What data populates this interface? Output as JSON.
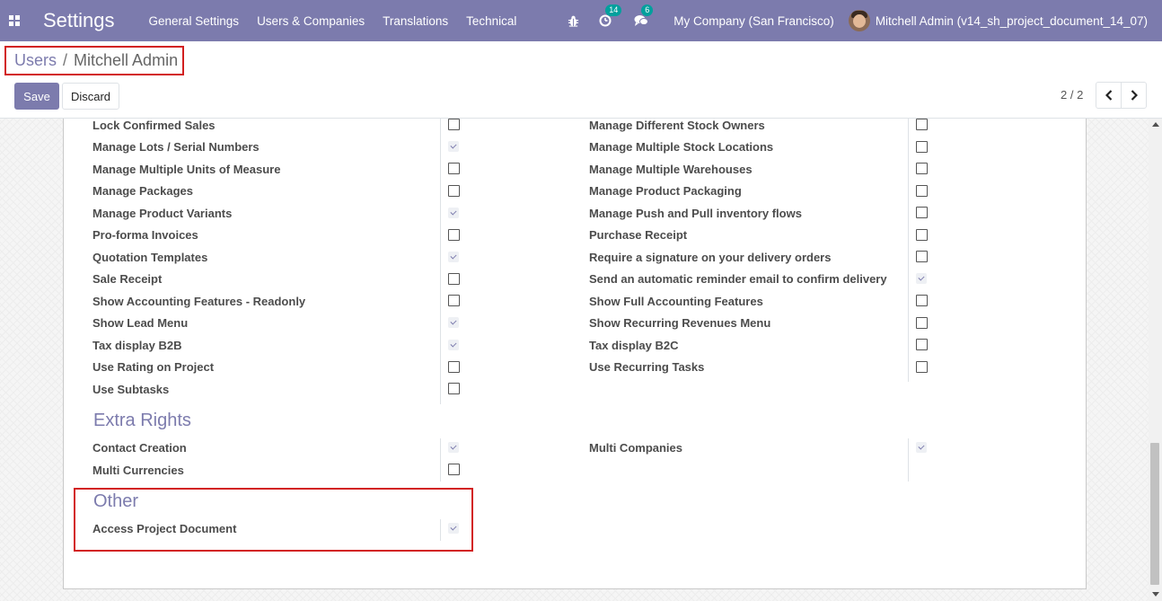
{
  "navbar": {
    "app_title": "Settings",
    "menu": [
      "General Settings",
      "Users & Companies",
      "Translations",
      "Technical"
    ],
    "activity_count": "14",
    "messages_count": "6",
    "company": "My Company (San Francisco)",
    "user": "Mitchell Admin (v14_sh_project_document_14_07)"
  },
  "breadcrumb": {
    "parent": "Users",
    "separator": "/",
    "current": "Mitchell Admin"
  },
  "buttons": {
    "save": "Save",
    "discard": "Discard"
  },
  "pager": {
    "value": "2 / 2"
  },
  "colors": {
    "brand": "#7c7bad",
    "highlight": "#d21f1f",
    "badge": "#00a09d"
  },
  "technical_rights": {
    "left": [
      {
        "label": "Lock Confirmed Sales",
        "checked": false
      },
      {
        "label": "Manage Lots / Serial Numbers",
        "checked": true
      },
      {
        "label": "Manage Multiple Units of Measure",
        "checked": false
      },
      {
        "label": "Manage Packages",
        "checked": false
      },
      {
        "label": "Manage Product Variants",
        "checked": true
      },
      {
        "label": "Pro-forma Invoices",
        "checked": false
      },
      {
        "label": "Quotation Templates",
        "checked": true
      },
      {
        "label": "Sale Receipt",
        "checked": false
      },
      {
        "label": "Show Accounting Features - Readonly",
        "checked": false
      },
      {
        "label": "Show Lead Menu",
        "checked": true
      },
      {
        "label": "Tax display B2B",
        "checked": true
      },
      {
        "label": "Use Rating on Project",
        "checked": false
      },
      {
        "label": "Use Subtasks",
        "checked": false
      }
    ],
    "right": [
      {
        "label": "Manage Different Stock Owners",
        "checked": false
      },
      {
        "label": "Manage Multiple Stock Locations",
        "checked": false
      },
      {
        "label": "Manage Multiple Warehouses",
        "checked": false
      },
      {
        "label": "Manage Product Packaging",
        "checked": false
      },
      {
        "label": "Manage Push and Pull inventory flows",
        "checked": false
      },
      {
        "label": "Purchase Receipt",
        "checked": false
      },
      {
        "label": "Require a signature on your delivery orders",
        "checked": false
      },
      {
        "label": "Send an automatic reminder email to confirm delivery",
        "checked": true
      },
      {
        "label": "Show Full Accounting Features",
        "checked": false
      },
      {
        "label": "Show Recurring Revenues Menu",
        "checked": false
      },
      {
        "label": "Tax display B2C",
        "checked": false
      },
      {
        "label": "Use Recurring Tasks",
        "checked": false
      }
    ]
  },
  "extra_rights": {
    "title": "Extra Rights",
    "left": [
      {
        "label": "Contact Creation",
        "checked": true
      },
      {
        "label": "Multi Currencies",
        "checked": false
      }
    ],
    "right": [
      {
        "label": "Multi Companies",
        "checked": true
      }
    ]
  },
  "other": {
    "title": "Other",
    "items": [
      {
        "label": "Access Project Document",
        "checked": true
      }
    ]
  }
}
